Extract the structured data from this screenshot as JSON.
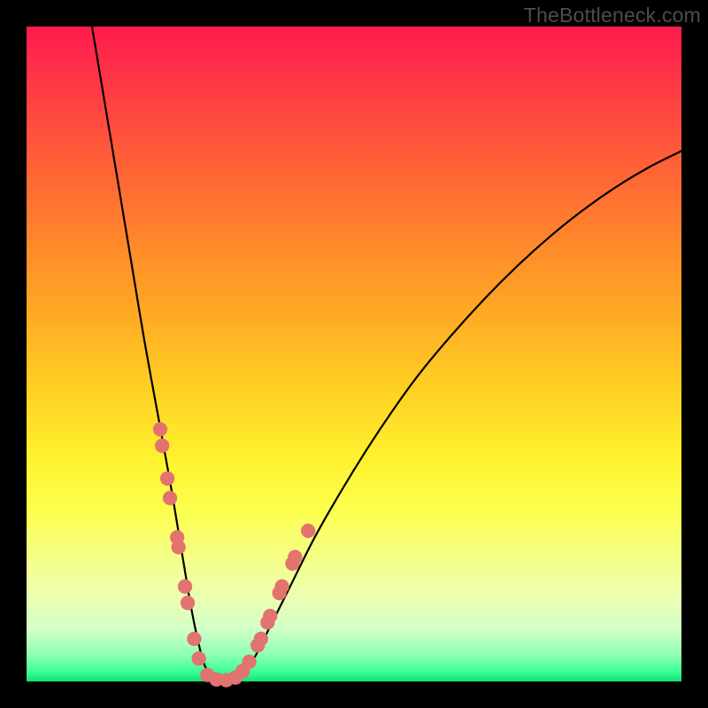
{
  "watermark": "TheBottleneck.com",
  "chart_data": {
    "type": "line",
    "title": "",
    "xlabel": "",
    "ylabel": "",
    "xlim": [
      0,
      100
    ],
    "ylim": [
      0,
      100
    ],
    "grid": false,
    "legend": false,
    "axes_visible": false,
    "gradient_stops": [
      {
        "pos": 0,
        "color": "#ff1a4d"
      },
      {
        "pos": 0.06,
        "color": "#ff2f49"
      },
      {
        "pos": 0.14,
        "color": "#ff4a3f"
      },
      {
        "pos": 0.24,
        "color": "#ff6a33"
      },
      {
        "pos": 0.34,
        "color": "#ff8b2a"
      },
      {
        "pos": 0.44,
        "color": "#ffaa24"
      },
      {
        "pos": 0.56,
        "color": "#ffd224"
      },
      {
        "pos": 0.66,
        "color": "#fff22e"
      },
      {
        "pos": 0.74,
        "color": "#fcff4f"
      },
      {
        "pos": 0.81,
        "color": "#f5ff86"
      },
      {
        "pos": 0.87,
        "color": "#ecffb0"
      },
      {
        "pos": 0.92,
        "color": "#d2ffc8"
      },
      {
        "pos": 0.96,
        "color": "#8dffb4"
      },
      {
        "pos": 0.985,
        "color": "#3cff97"
      },
      {
        "pos": 1.0,
        "color": "#11e077"
      }
    ],
    "series": [
      {
        "name": "curve",
        "color": "#000000",
        "stroke_width": 2.2,
        "x": [
          10.0,
          12.0,
          14.0,
          16.0,
          18.0,
          20.0,
          22.0,
          24.0,
          25.0,
          26.0,
          27.0,
          28.0,
          29.0,
          30.0,
          31.0,
          32.0,
          33.0,
          35.0,
          37.0,
          40.0,
          44.0,
          48.0,
          52.0,
          56.0,
          60.0,
          65.0,
          70.0,
          75.0,
          80.0,
          85.0,
          90.0,
          95.0,
          100.0
        ],
        "y": [
          100.0,
          88.0,
          76.0,
          64.0,
          52.0,
          41.0,
          30.0,
          18.0,
          12.0,
          7.0,
          3.0,
          1.0,
          0.3,
          0.2,
          0.2,
          0.4,
          1.2,
          4.0,
          8.0,
          14.0,
          22.0,
          29.0,
          35.5,
          41.5,
          47.0,
          53.0,
          58.5,
          63.5,
          68.0,
          72.0,
          75.5,
          78.5,
          81.0
        ]
      }
    ],
    "markers": {
      "color": "#e2736f",
      "radius": 1.1,
      "points_xy": [
        [
          20.4,
          38.5
        ],
        [
          20.7,
          36.0
        ],
        [
          21.5,
          31.0
        ],
        [
          21.9,
          28.0
        ],
        [
          23.0,
          22.0
        ],
        [
          23.2,
          20.5
        ],
        [
          24.2,
          14.5
        ],
        [
          24.6,
          12.0
        ],
        [
          25.6,
          6.5
        ],
        [
          26.3,
          3.5
        ],
        [
          27.6,
          1.0
        ],
        [
          29.0,
          0.3
        ],
        [
          30.5,
          0.2
        ],
        [
          31.9,
          0.6
        ],
        [
          33.0,
          1.6
        ],
        [
          34.0,
          3.0
        ],
        [
          35.3,
          5.5
        ],
        [
          35.8,
          6.5
        ],
        [
          36.8,
          9.0
        ],
        [
          37.2,
          10.0
        ],
        [
          38.6,
          13.5
        ],
        [
          39.0,
          14.5
        ],
        [
          40.6,
          18.0
        ],
        [
          41.0,
          19.0
        ],
        [
          43.0,
          23.0
        ]
      ]
    }
  }
}
